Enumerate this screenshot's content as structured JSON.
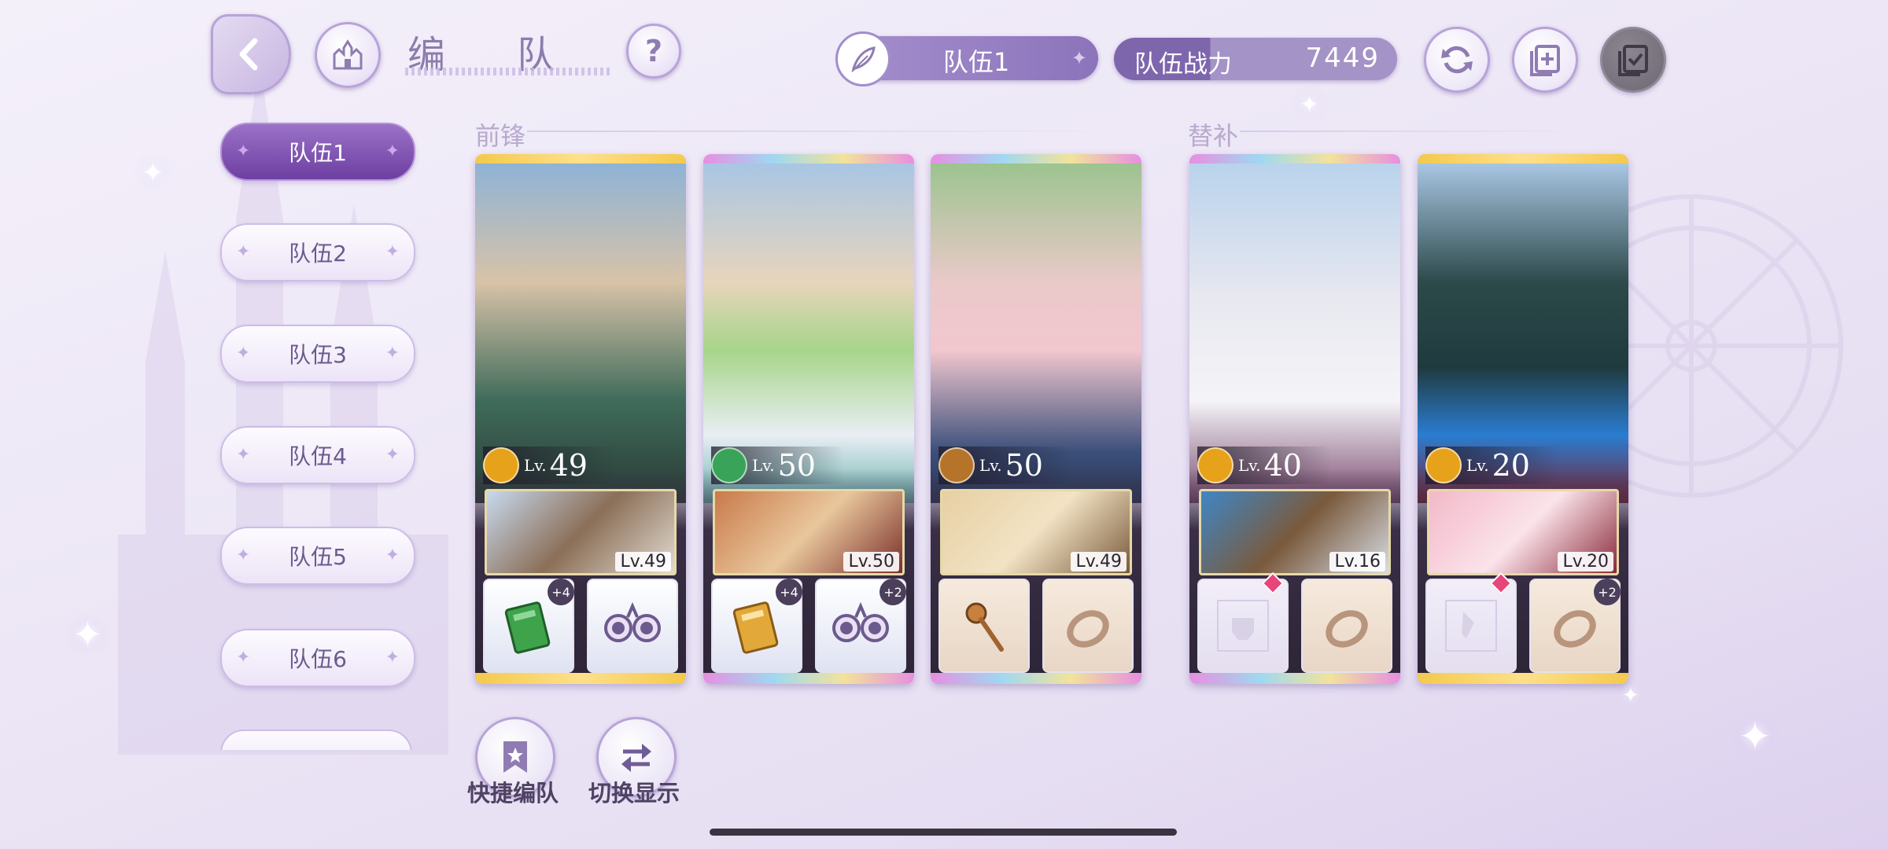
{
  "header": {
    "title": "编 队",
    "team_selector": "队伍1",
    "power_label": "队伍战力",
    "power_value": "7449"
  },
  "sidebar": {
    "teams": [
      "队伍1",
      "队伍2",
      "队伍3",
      "队伍4",
      "队伍5",
      "队伍6"
    ],
    "active_index": 0
  },
  "sections": {
    "front": "前锋",
    "sub": "替补"
  },
  "cards": [
    {
      "lv_prefix": "Lv.",
      "level": "49",
      "sub_level": "Lv.49",
      "item1_plus": "+4",
      "item2_plus": "",
      "badge_color": "#e6a21a",
      "frame": "gold"
    },
    {
      "lv_prefix": "Lv.",
      "level": "50",
      "sub_level": "Lv.50",
      "item1_plus": "+4",
      "item2_plus": "+2",
      "badge_color": "#3aa35a",
      "frame": "rainbow"
    },
    {
      "lv_prefix": "Lv.",
      "level": "50",
      "sub_level": "Lv.49",
      "item1_plus": "",
      "item2_plus": "",
      "badge_color": "#b5742a",
      "frame": "rainbow"
    },
    {
      "lv_prefix": "Lv.",
      "level": "40",
      "sub_level": "Lv.16",
      "item1_plus": "",
      "item2_plus": "",
      "badge_color": "#e6a21a",
      "frame": "rainbow"
    },
    {
      "lv_prefix": "Lv.",
      "level": "20",
      "sub_level": "Lv.20",
      "item1_plus": "",
      "item2_plus": "+2",
      "badge_color": "#e6a21a",
      "frame": "gold"
    }
  ],
  "bottom": {
    "quick_team": "快捷编队",
    "switch_display": "切换显示"
  },
  "colors": {
    "accent": "#7e66ad",
    "active_tab": "#6d3fa2",
    "gold_frame": "#f0c24a"
  }
}
